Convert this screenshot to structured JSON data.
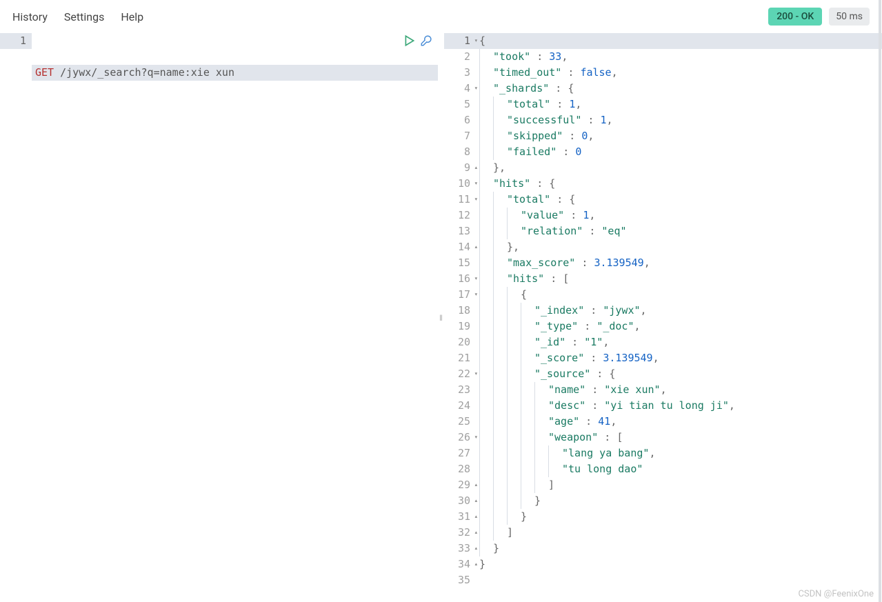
{
  "menu": {
    "history": "History",
    "settings": "Settings",
    "help": "Help"
  },
  "status": {
    "code_label": "200 - OK",
    "time_label": "50 ms"
  },
  "request": {
    "lines": [
      "1"
    ],
    "method": "GET",
    "path": " /jywx/_search?q=name:xie xun"
  },
  "response_lines": [
    {
      "n": "1",
      "fold": "▾",
      "hl": true,
      "seg": [
        [
          "pn",
          "{"
        ]
      ]
    },
    {
      "n": "2",
      "seg": [
        [
          "ind",
          ""
        ],
        [
          "key",
          "\"took\""
        ],
        [
          "pn",
          " : "
        ],
        [
          "num",
          "33"
        ],
        [
          "pn",
          ","
        ]
      ]
    },
    {
      "n": "3",
      "seg": [
        [
          "ind",
          ""
        ],
        [
          "key",
          "\"timed_out\""
        ],
        [
          "pn",
          " : "
        ],
        [
          "bool",
          "false"
        ],
        [
          "pn",
          ","
        ]
      ]
    },
    {
      "n": "4",
      "fold": "▾",
      "seg": [
        [
          "ind",
          ""
        ],
        [
          "key",
          "\"_shards\""
        ],
        [
          "pn",
          " : {"
        ]
      ]
    },
    {
      "n": "5",
      "seg": [
        [
          "ind",
          ""
        ],
        [
          "ind",
          ""
        ],
        [
          "key",
          "\"total\""
        ],
        [
          "pn",
          " : "
        ],
        [
          "num",
          "1"
        ],
        [
          "pn",
          ","
        ]
      ]
    },
    {
      "n": "6",
      "seg": [
        [
          "ind",
          ""
        ],
        [
          "ind",
          ""
        ],
        [
          "key",
          "\"successful\""
        ],
        [
          "pn",
          " : "
        ],
        [
          "num",
          "1"
        ],
        [
          "pn",
          ","
        ]
      ]
    },
    {
      "n": "7",
      "seg": [
        [
          "ind",
          ""
        ],
        [
          "ind",
          ""
        ],
        [
          "key",
          "\"skipped\""
        ],
        [
          "pn",
          " : "
        ],
        [
          "num",
          "0"
        ],
        [
          "pn",
          ","
        ]
      ]
    },
    {
      "n": "8",
      "seg": [
        [
          "ind",
          ""
        ],
        [
          "ind",
          ""
        ],
        [
          "key",
          "\"failed\""
        ],
        [
          "pn",
          " : "
        ],
        [
          "num",
          "0"
        ]
      ]
    },
    {
      "n": "9",
      "fold": "▴",
      "seg": [
        [
          "ind",
          ""
        ],
        [
          "pn",
          "},"
        ]
      ]
    },
    {
      "n": "10",
      "fold": "▾",
      "seg": [
        [
          "ind",
          ""
        ],
        [
          "key",
          "\"hits\""
        ],
        [
          "pn",
          " : {"
        ]
      ]
    },
    {
      "n": "11",
      "fold": "▾",
      "seg": [
        [
          "ind",
          ""
        ],
        [
          "ind",
          ""
        ],
        [
          "key",
          "\"total\""
        ],
        [
          "pn",
          " : {"
        ]
      ]
    },
    {
      "n": "12",
      "seg": [
        [
          "ind",
          ""
        ],
        [
          "ind",
          ""
        ],
        [
          "ind",
          ""
        ],
        [
          "key",
          "\"value\""
        ],
        [
          "pn",
          " : "
        ],
        [
          "num",
          "1"
        ],
        [
          "pn",
          ","
        ]
      ]
    },
    {
      "n": "13",
      "seg": [
        [
          "ind",
          ""
        ],
        [
          "ind",
          ""
        ],
        [
          "ind",
          ""
        ],
        [
          "key",
          "\"relation\""
        ],
        [
          "pn",
          " : "
        ],
        [
          "str",
          "\"eq\""
        ]
      ]
    },
    {
      "n": "14",
      "fold": "▴",
      "seg": [
        [
          "ind",
          ""
        ],
        [
          "ind",
          ""
        ],
        [
          "pn",
          "},"
        ]
      ]
    },
    {
      "n": "15",
      "seg": [
        [
          "ind",
          ""
        ],
        [
          "ind",
          ""
        ],
        [
          "key",
          "\"max_score\""
        ],
        [
          "pn",
          " : "
        ],
        [
          "num",
          "3.139549"
        ],
        [
          "pn",
          ","
        ]
      ]
    },
    {
      "n": "16",
      "fold": "▾",
      "seg": [
        [
          "ind",
          ""
        ],
        [
          "ind",
          ""
        ],
        [
          "key",
          "\"hits\""
        ],
        [
          "pn",
          " : ["
        ]
      ]
    },
    {
      "n": "17",
      "fold": "▾",
      "seg": [
        [
          "ind",
          ""
        ],
        [
          "ind",
          ""
        ],
        [
          "ind",
          ""
        ],
        [
          "pn",
          "{"
        ]
      ]
    },
    {
      "n": "18",
      "seg": [
        [
          "ind",
          ""
        ],
        [
          "ind",
          ""
        ],
        [
          "ind",
          ""
        ],
        [
          "ind",
          ""
        ],
        [
          "key",
          "\"_index\""
        ],
        [
          "pn",
          " : "
        ],
        [
          "str",
          "\"jywx\""
        ],
        [
          "pn",
          ","
        ]
      ]
    },
    {
      "n": "19",
      "seg": [
        [
          "ind",
          ""
        ],
        [
          "ind",
          ""
        ],
        [
          "ind",
          ""
        ],
        [
          "ind",
          ""
        ],
        [
          "key",
          "\"_type\""
        ],
        [
          "pn",
          " : "
        ],
        [
          "str",
          "\"_doc\""
        ],
        [
          "pn",
          ","
        ]
      ]
    },
    {
      "n": "20",
      "seg": [
        [
          "ind",
          ""
        ],
        [
          "ind",
          ""
        ],
        [
          "ind",
          ""
        ],
        [
          "ind",
          ""
        ],
        [
          "key",
          "\"_id\""
        ],
        [
          "pn",
          " : "
        ],
        [
          "str",
          "\"1\""
        ],
        [
          "pn",
          ","
        ]
      ]
    },
    {
      "n": "21",
      "seg": [
        [
          "ind",
          ""
        ],
        [
          "ind",
          ""
        ],
        [
          "ind",
          ""
        ],
        [
          "ind",
          ""
        ],
        [
          "key",
          "\"_score\""
        ],
        [
          "pn",
          " : "
        ],
        [
          "num",
          "3.139549"
        ],
        [
          "pn",
          ","
        ]
      ]
    },
    {
      "n": "22",
      "fold": "▾",
      "seg": [
        [
          "ind",
          ""
        ],
        [
          "ind",
          ""
        ],
        [
          "ind",
          ""
        ],
        [
          "ind",
          ""
        ],
        [
          "key",
          "\"_source\""
        ],
        [
          "pn",
          " : {"
        ]
      ]
    },
    {
      "n": "23",
      "seg": [
        [
          "ind",
          ""
        ],
        [
          "ind",
          ""
        ],
        [
          "ind",
          ""
        ],
        [
          "ind",
          ""
        ],
        [
          "ind",
          ""
        ],
        [
          "key",
          "\"name\""
        ],
        [
          "pn",
          " : "
        ],
        [
          "str",
          "\"xie xun\""
        ],
        [
          "pn",
          ","
        ]
      ]
    },
    {
      "n": "24",
      "seg": [
        [
          "ind",
          ""
        ],
        [
          "ind",
          ""
        ],
        [
          "ind",
          ""
        ],
        [
          "ind",
          ""
        ],
        [
          "ind",
          ""
        ],
        [
          "key",
          "\"desc\""
        ],
        [
          "pn",
          " : "
        ],
        [
          "str",
          "\"yi tian tu long ji\""
        ],
        [
          "pn",
          ","
        ]
      ]
    },
    {
      "n": "25",
      "seg": [
        [
          "ind",
          ""
        ],
        [
          "ind",
          ""
        ],
        [
          "ind",
          ""
        ],
        [
          "ind",
          ""
        ],
        [
          "ind",
          ""
        ],
        [
          "key",
          "\"age\""
        ],
        [
          "pn",
          " : "
        ],
        [
          "num",
          "41"
        ],
        [
          "pn",
          ","
        ]
      ]
    },
    {
      "n": "26",
      "fold": "▾",
      "seg": [
        [
          "ind",
          ""
        ],
        [
          "ind",
          ""
        ],
        [
          "ind",
          ""
        ],
        [
          "ind",
          ""
        ],
        [
          "ind",
          ""
        ],
        [
          "key",
          "\"weapon\""
        ],
        [
          "pn",
          " : ["
        ]
      ]
    },
    {
      "n": "27",
      "seg": [
        [
          "ind",
          ""
        ],
        [
          "ind",
          ""
        ],
        [
          "ind",
          ""
        ],
        [
          "ind",
          ""
        ],
        [
          "ind",
          ""
        ],
        [
          "ind",
          ""
        ],
        [
          "str",
          "\"lang ya bang\""
        ],
        [
          "pn",
          ","
        ]
      ]
    },
    {
      "n": "28",
      "seg": [
        [
          "ind",
          ""
        ],
        [
          "ind",
          ""
        ],
        [
          "ind",
          ""
        ],
        [
          "ind",
          ""
        ],
        [
          "ind",
          ""
        ],
        [
          "ind",
          ""
        ],
        [
          "str",
          "\"tu long dao\""
        ]
      ]
    },
    {
      "n": "29",
      "fold": "▴",
      "seg": [
        [
          "ind",
          ""
        ],
        [
          "ind",
          ""
        ],
        [
          "ind",
          ""
        ],
        [
          "ind",
          ""
        ],
        [
          "ind",
          ""
        ],
        [
          "pn",
          "]"
        ]
      ]
    },
    {
      "n": "30",
      "fold": "▴",
      "seg": [
        [
          "ind",
          ""
        ],
        [
          "ind",
          ""
        ],
        [
          "ind",
          ""
        ],
        [
          "ind",
          ""
        ],
        [
          "pn",
          "}"
        ]
      ]
    },
    {
      "n": "31",
      "fold": "▴",
      "seg": [
        [
          "ind",
          ""
        ],
        [
          "ind",
          ""
        ],
        [
          "ind",
          ""
        ],
        [
          "pn",
          "}"
        ]
      ]
    },
    {
      "n": "32",
      "fold": "▴",
      "seg": [
        [
          "ind",
          ""
        ],
        [
          "ind",
          ""
        ],
        [
          "pn",
          "]"
        ]
      ]
    },
    {
      "n": "33",
      "fold": "▴",
      "seg": [
        [
          "ind",
          ""
        ],
        [
          "pn",
          "}"
        ]
      ]
    },
    {
      "n": "34",
      "fold": "▴",
      "seg": [
        [
          "pn",
          "}"
        ]
      ]
    },
    {
      "n": "35",
      "seg": []
    }
  ],
  "watermark": "CSDN @FeenixOne"
}
